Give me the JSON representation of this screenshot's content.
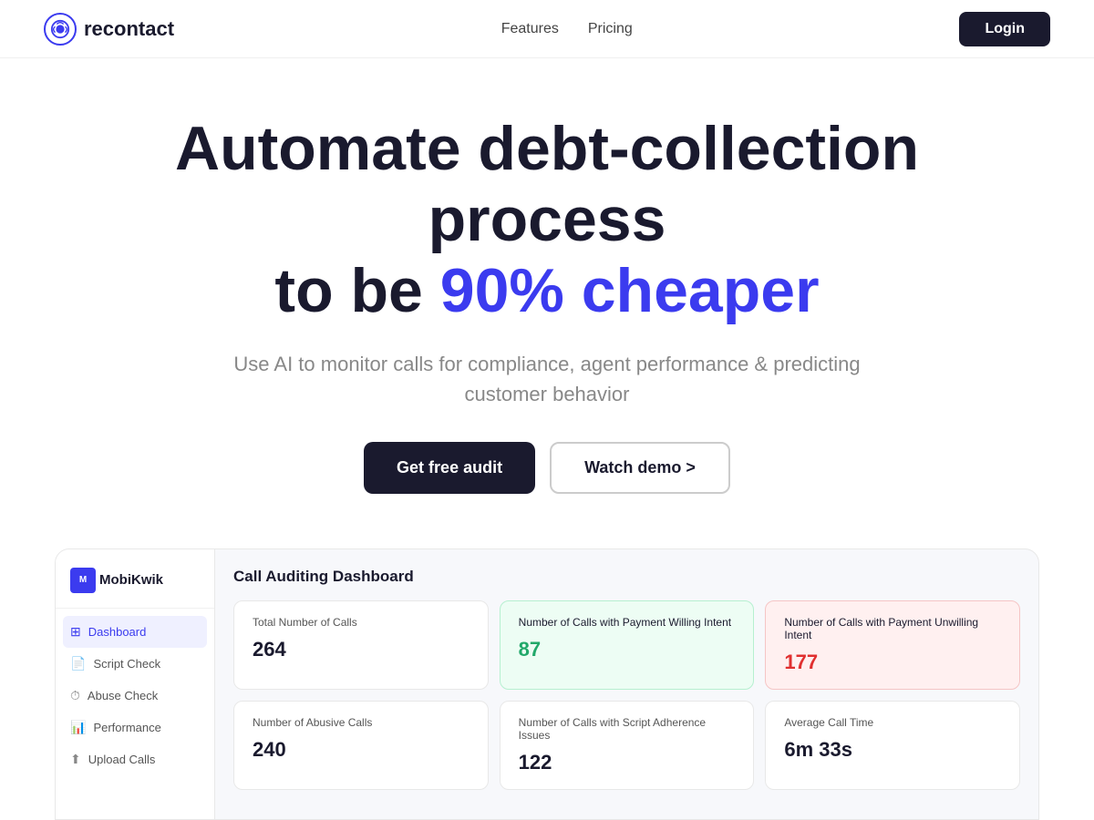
{
  "nav": {
    "logo_text": "recontact",
    "links": [
      {
        "label": "Features",
        "id": "features"
      },
      {
        "label": "Pricing",
        "id": "pricing"
      }
    ],
    "login_label": "Login"
  },
  "hero": {
    "title_part1": "Automate debt-collection process",
    "title_part2": "to be ",
    "title_accent": "90% cheaper",
    "subtitle": "Use AI to monitor calls for compliance, agent performance & predicting customer behavior",
    "cta_primary": "Get free audit",
    "cta_secondary": "Watch demo >"
  },
  "dashboard": {
    "title": "Call Auditing Dashboard",
    "sidebar_brand": "MobiKwik",
    "sidebar_items": [
      {
        "label": "Dashboard",
        "active": true
      },
      {
        "label": "Script Check",
        "active": false
      },
      {
        "label": "Abuse Check",
        "active": false
      },
      {
        "label": "Performance",
        "active": false
      },
      {
        "label": "Upload Calls",
        "active": false
      }
    ],
    "cards_row1": [
      {
        "label": "Total Number of Calls",
        "value": "264",
        "tint": "white"
      },
      {
        "label": "Number of Calls with Payment Willing Intent",
        "value": "87",
        "tint": "green"
      },
      {
        "label": "Number of Calls with Payment Unwilling Intent",
        "value": "177",
        "tint": "pink"
      }
    ],
    "cards_row2": [
      {
        "label": "Number of Abusive Calls",
        "value": "240",
        "tint": "white"
      },
      {
        "label": "Number of Calls with Script Adherence Issues",
        "value": "122",
        "tint": "white"
      },
      {
        "label": "Average Call Time",
        "value": "6m 33s",
        "tint": "white"
      }
    ]
  }
}
